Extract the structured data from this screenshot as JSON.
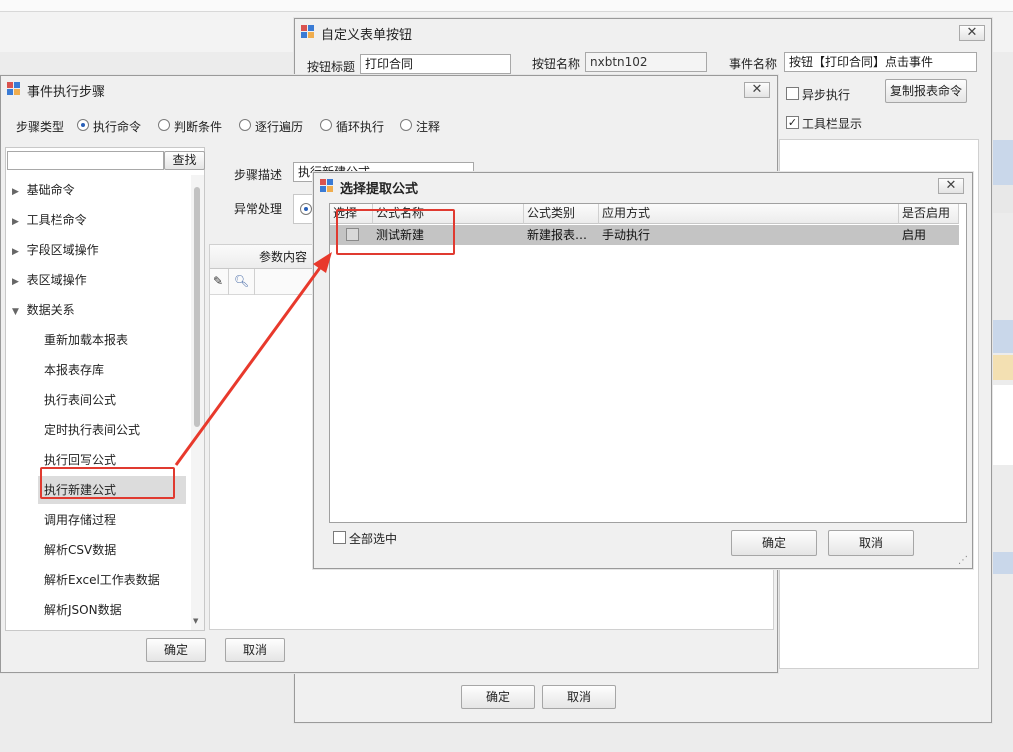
{
  "custom_button_window": {
    "title": "自定义表单按钮",
    "button_title_label": "按钮标题",
    "button_title_value": "打印合同",
    "button_name_label": "按钮名称",
    "button_name_value": "nxbtn102",
    "event_name_label": "事件名称",
    "event_name_value": "按钮【打印合同】点击事件",
    "async_label": "异步执行",
    "copy_report_cmd_label": "复制报表命令",
    "toolbar_show_label": "工具栏显示",
    "ok_label": "确定",
    "cancel_label": "取消"
  },
  "event_steps_window": {
    "title": "事件执行步骤",
    "step_type_label": "步骤类型",
    "step_types": [
      "执行命令",
      "判断条件",
      "逐行遍历",
      "循环执行",
      "注释"
    ],
    "search_value": "",
    "search_button": "查找",
    "tree_groups": [
      "基础命令",
      "工具栏命令",
      "字段区域操作",
      "表区域操作",
      "数据关系"
    ],
    "tree_children": [
      "重新加载本报表",
      "本报表存库",
      "执行表间公式",
      "定时执行表间公式",
      "执行回写公式",
      "执行新建公式",
      "调用存储过程",
      "解析CSV数据",
      "解析Excel工作表数据",
      "解析JSON数据"
    ],
    "step_desc_label": "步骤描述",
    "step_desc_value": "执行新建公式",
    "exception_label": "异常处理",
    "param_header": "参数内容",
    "ok_label": "确定",
    "cancel_label": "取消"
  },
  "select_formula_window": {
    "title": "选择提取公式",
    "columns": [
      "选择",
      "公式名称",
      "公式类别",
      "应用方式",
      "是否启用"
    ],
    "rows": [
      {
        "selected": false,
        "name": "测试新建",
        "category": "新建报表…",
        "mode": "手动执行",
        "enabled": "启用"
      }
    ],
    "select_all_label": "全部选中",
    "ok_label": "确定",
    "cancel_label": "取消"
  },
  "colors": {
    "highlight_red": "#e03a30",
    "selected_row": "#c4c4c4",
    "tree_selected": "#dcdcdc"
  }
}
